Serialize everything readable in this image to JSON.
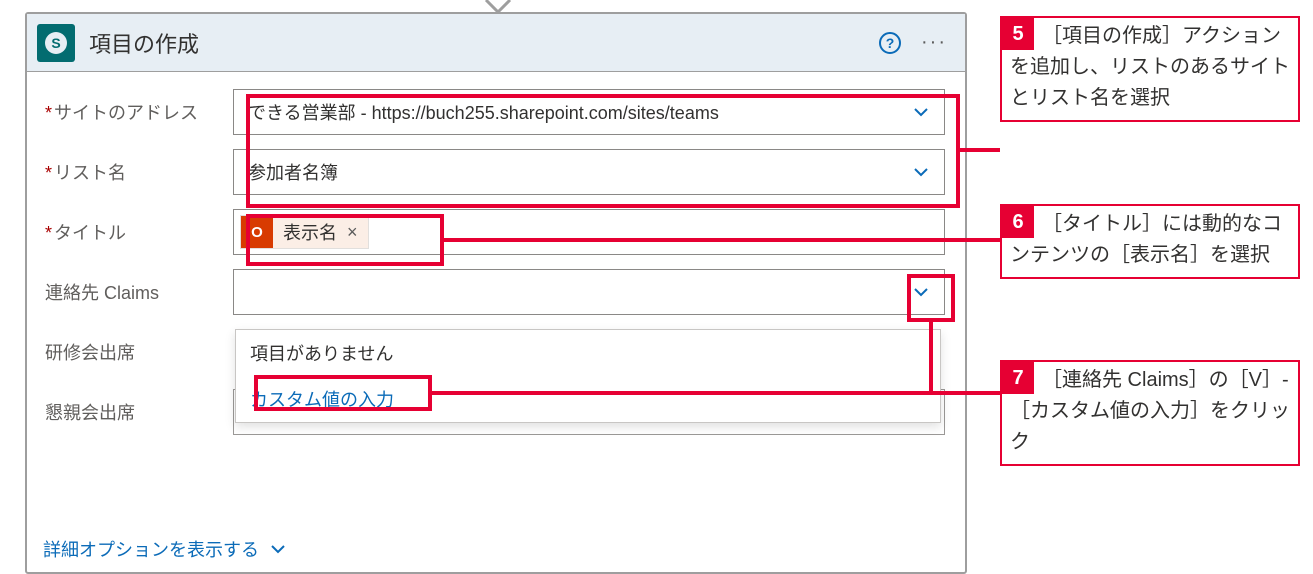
{
  "action": {
    "title": "項目の作成",
    "fields": {
      "site": {
        "label": "サイトのアドレス",
        "required": true,
        "value": "できる営業部 - https://buch255.sharepoint.com/sites/teams"
      },
      "list": {
        "label": "リスト名",
        "required": true,
        "value": "参加者名簿"
      },
      "title": {
        "label": "タイトル",
        "required": true,
        "token_name": "表示名",
        "token_icon_letter": "O"
      },
      "claims": {
        "label": "連絡先 Claims",
        "required": false
      },
      "training": {
        "label": "研修会出席",
        "required": false
      },
      "party": {
        "label": "懇親会出席",
        "required": false
      }
    },
    "dropdown": {
      "no_items": "項目がありません",
      "custom": "カスタム値の入力"
    },
    "advanced": "詳細オプションを表示する"
  },
  "callouts": {
    "c5": {
      "num": "5",
      "text": "［項目の作成］アクションを追加し、リストのあるサイトとリスト名を選択"
    },
    "c6": {
      "num": "6",
      "text": "［タイトル］には動的なコンテンツの［表示名］を選択"
    },
    "c7": {
      "num": "7",
      "text": "［連絡先 Claims］の［V］-［カスタム値の入力］をクリック"
    }
  }
}
